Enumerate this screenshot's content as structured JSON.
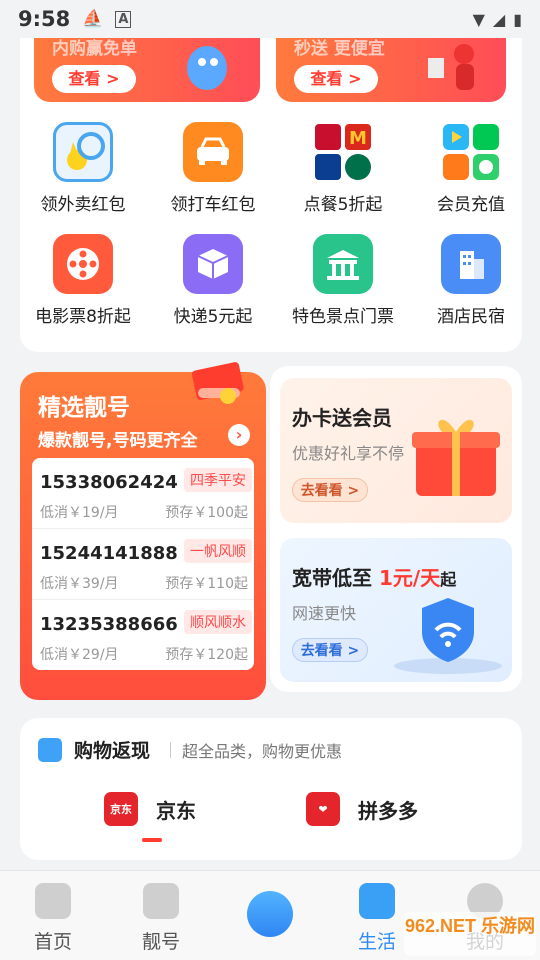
{
  "status_bar": {
    "time": "9:58"
  },
  "banners": [
    {
      "title": "内购赢免单",
      "button": "查看 >"
    },
    {
      "title": "秒送 更便宜",
      "button": "查看 >"
    }
  ],
  "grid": [
    {
      "label": "领外卖红包",
      "icon": "takeout-icon",
      "color": "#4aa6ee"
    },
    {
      "label": "领打车红包",
      "icon": "car-icon",
      "color": "#ff8a1f"
    },
    {
      "label": "点餐5折起",
      "icon": "food-brands-icon",
      "color": "#ffffff"
    },
    {
      "label": "会员充值",
      "icon": "video-vip-icon",
      "color": "#ffffff"
    },
    {
      "label": "电影票8折起",
      "icon": "film-reel-icon",
      "color": "#ff5a3c"
    },
    {
      "label": "快递5元起",
      "icon": "package-box-icon",
      "color": "#8a6cf5"
    },
    {
      "label": "特色景点门票",
      "icon": "temple-icon",
      "color": "#29c38c"
    },
    {
      "label": "酒店民宿",
      "icon": "hotel-building-icon",
      "color": "#4b8df6"
    }
  ],
  "numbers_card": {
    "title": "精选靓号",
    "subtitle": "爆款靓号,号码更齐全",
    "rows": [
      {
        "number": "15338062424",
        "badge": "四季平安",
        "fee": "低消￥19/月",
        "prestore": "预存￥100起"
      },
      {
        "number": "15244141888",
        "badge": "一帆风顺",
        "fee": "低消￥39/月",
        "prestore": "预存￥110起"
      },
      {
        "number": "13235388666",
        "badge": "顺风顺水",
        "fee": "低消￥29/月",
        "prestore": "预存￥120起"
      }
    ]
  },
  "promo_cards": [
    {
      "title": "办卡送会员",
      "subtitle": "优惠好礼享不停",
      "button": "去看看 >"
    },
    {
      "title_prefix": "宽带低至",
      "title_price": "1元/天",
      "title_suffix": "起",
      "subtitle": "网速更快",
      "button": "去看看 >"
    }
  ],
  "shopping": {
    "title": "购物返现",
    "subtitle": "超全品类，购物更优惠",
    "stores": [
      {
        "name": "京东",
        "logo_text": "京东"
      },
      {
        "name": "拼多多"
      }
    ]
  },
  "nav": [
    {
      "label": "首页"
    },
    {
      "label": "靓号"
    },
    {
      "label": "生活"
    },
    {
      "label": "我的"
    }
  ],
  "watermark": "962.NET 乐游网"
}
